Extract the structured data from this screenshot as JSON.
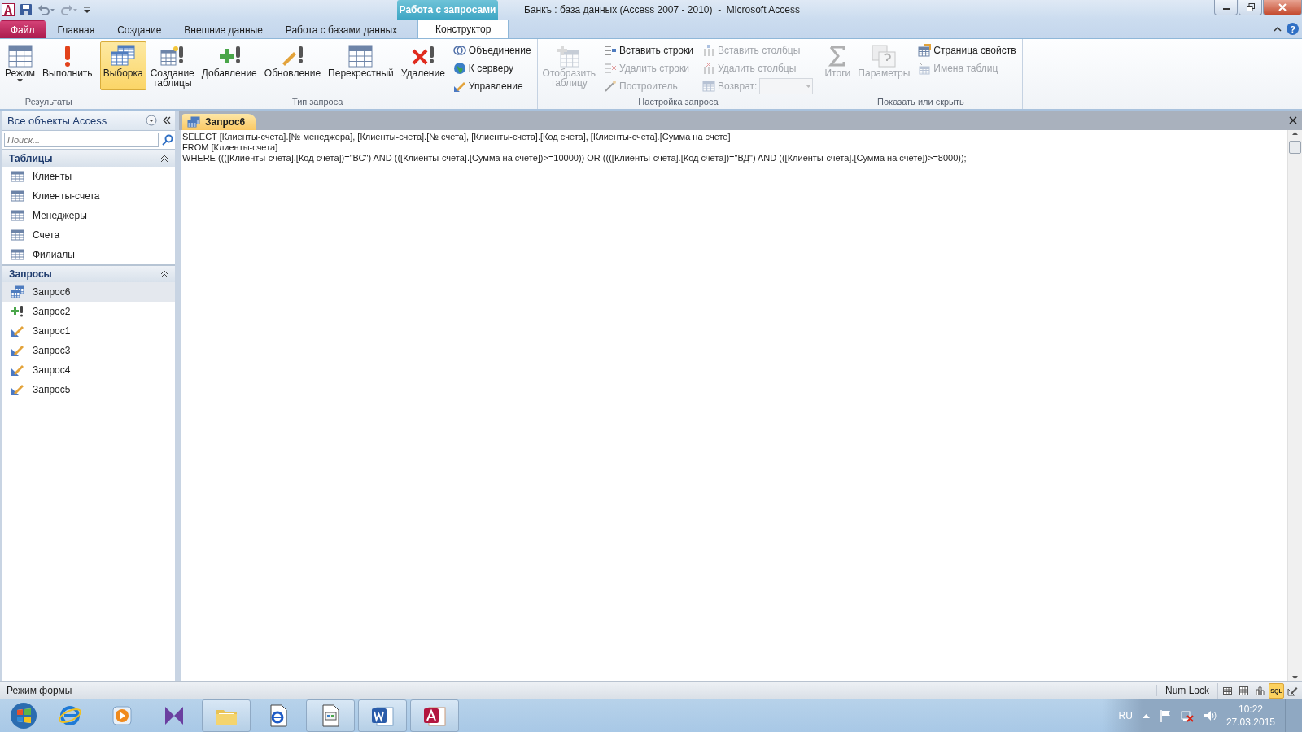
{
  "window": {
    "title": "Банкъ : база данных (Access 2007 - 2010)  -  Microsoft Access",
    "contextual_group": "Работа с запросами",
    "help": "?"
  },
  "ribbon_tabs": [
    {
      "label": "Файл",
      "kind": "file",
      "selected": false
    },
    {
      "label": "Главная",
      "kind": "tab",
      "selected": false
    },
    {
      "label": "Создание",
      "kind": "tab",
      "selected": false
    },
    {
      "label": "Внешние данные",
      "kind": "tab",
      "selected": false
    },
    {
      "label": "Работа с базами данных",
      "kind": "tab",
      "selected": false
    },
    {
      "label": "Конструктор",
      "kind": "contextual",
      "selected": true
    }
  ],
  "ribbon_groups": [
    {
      "label": "Результаты",
      "items": [
        {
          "kind": "large",
          "label": "Режим",
          "dropdown": true,
          "disabled": false,
          "selected": false
        },
        {
          "kind": "large",
          "label": "Выполнить",
          "disabled": false,
          "selected": false
        }
      ]
    },
    {
      "label": "Тип запроса",
      "items": [
        {
          "kind": "large",
          "label": "Выборка",
          "disabled": false,
          "selected": true
        },
        {
          "kind": "large",
          "label": "Создание таблицы",
          "disabled": false,
          "selected": false
        },
        {
          "kind": "large",
          "label": "Добавление",
          "disabled": false,
          "selected": false
        },
        {
          "kind": "large",
          "label": "Обновление",
          "disabled": false,
          "selected": false
        },
        {
          "kind": "large",
          "label": "Перекрестный",
          "disabled": false,
          "selected": false
        },
        {
          "kind": "large",
          "label": "Удаление",
          "disabled": false,
          "selected": false
        },
        {
          "kind": "stack",
          "items": [
            {
              "kind": "small",
              "label": "Объединение",
              "disabled": false
            },
            {
              "kind": "small",
              "label": "К серверу",
              "disabled": false
            },
            {
              "kind": "small",
              "label": "Управление",
              "disabled": false
            }
          ]
        }
      ]
    },
    {
      "label": "Настройка запроса",
      "items": [
        {
          "kind": "large",
          "label": "Отобразить таблицу",
          "disabled": true,
          "selected": false
        },
        {
          "kind": "stack",
          "items": [
            {
              "kind": "small",
              "label": "Вставить строки",
              "disabled": false
            },
            {
              "kind": "small",
              "label": "Удалить строки",
              "disabled": true
            },
            {
              "kind": "small",
              "label": "Построитель",
              "disabled": true
            }
          ]
        },
        {
          "kind": "stack",
          "items": [
            {
              "kind": "small",
              "label": "Вставить столбцы",
              "disabled": true
            },
            {
              "kind": "small",
              "label": "Удалить столбцы",
              "disabled": true
            },
            {
              "kind": "combo",
              "label": "Возврат:",
              "disabled": true
            }
          ]
        }
      ]
    },
    {
      "label": "Показать или скрыть",
      "items": [
        {
          "kind": "large",
          "label": "Итоги",
          "disabled": true,
          "selected": false
        },
        {
          "kind": "large",
          "label": "Параметры",
          "disabled": true,
          "selected": false
        },
        {
          "kind": "stack",
          "items": [
            {
              "kind": "small",
              "label": "Страница свойств",
              "disabled": false
            },
            {
              "kind": "small",
              "label": "Имена таблиц",
              "disabled": true
            }
          ]
        }
      ]
    }
  ],
  "nav_pane": {
    "title": "Все объекты Access",
    "search": {
      "placeholder": "Поиск..."
    },
    "groups": [
      {
        "label": "Таблицы",
        "expanded": true,
        "items": [
          {
            "label": "Клиенты",
            "kind": "table",
            "selected": false
          },
          {
            "label": "Клиенты-счета",
            "kind": "table",
            "selected": false
          },
          {
            "label": "Менеджеры",
            "kind": "table",
            "selected": false
          },
          {
            "label": "Счета",
            "kind": "table",
            "selected": false
          },
          {
            "label": "Филиалы",
            "kind": "table",
            "selected": false
          }
        ]
      },
      {
        "label": "Запросы",
        "expanded": true,
        "items": [
          {
            "label": "Запрос6",
            "kind": "select",
            "selected": true
          },
          {
            "label": "Запрос2",
            "kind": "append",
            "selected": false
          },
          {
            "label": "Запрос1",
            "kind": "update",
            "selected": false
          },
          {
            "label": "Запрос3",
            "kind": "update",
            "selected": false
          },
          {
            "label": "Запрос4",
            "kind": "update",
            "selected": false
          },
          {
            "label": "Запрос5",
            "kind": "update",
            "selected": false
          }
        ]
      }
    ]
  },
  "document_tab": {
    "label": "Запрос6"
  },
  "sql_lines": [
    "SELECT [Клиенты-счета].[№ менеджера], [Клиенты-счета].[№ счета], [Клиенты-счета].[Код счета], [Клиенты-счета].[Сумма на счете]",
    "FROM [Клиенты-счета]",
    "WHERE ((([Клиенты-счета].[Код счета])=\"ВС\") AND (([Клиенты-счета].[Сумма на счете])>=10000)) OR ((([Клиенты-счета].[Код счета])=\"ВД\") AND (([Клиенты-счета].[Сумма на счете])>=8000));"
  ],
  "status_bar": {
    "text": "Режим формы",
    "indicator": "Num Lock",
    "views": [
      {
        "kind": "datasheet",
        "selected": false
      },
      {
        "kind": "pivot-table",
        "selected": false
      },
      {
        "kind": "pivot-chart",
        "selected": false
      },
      {
        "kind": "sql",
        "label": "SQL",
        "selected": true
      },
      {
        "kind": "design",
        "selected": false
      }
    ]
  },
  "taskbar": {
    "apps": [
      {
        "kind": "browser",
        "open": false
      },
      {
        "kind": "player",
        "open": false
      },
      {
        "kind": "studio",
        "open": false
      },
      {
        "kind": "folder",
        "open": true
      },
      {
        "kind": "browser-doc",
        "open": false
      },
      {
        "kind": "document",
        "open": true
      },
      {
        "kind": "word",
        "open": true
      },
      {
        "kind": "access",
        "open": true
      }
    ],
    "language": "RU",
    "time": "10:22",
    "date": "27.03.2015"
  }
}
